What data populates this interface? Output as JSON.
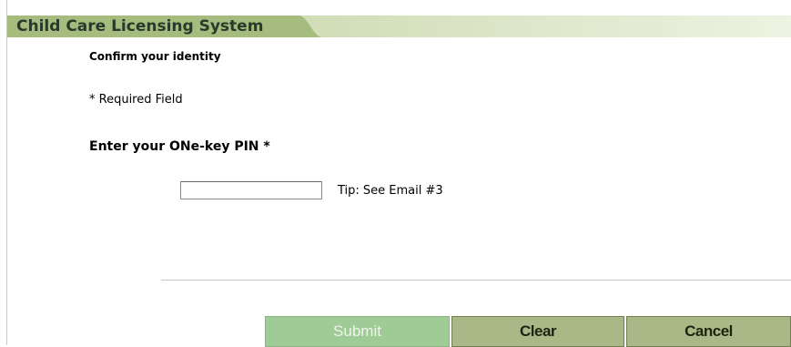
{
  "header": {
    "app_title": "Child Care Licensing System"
  },
  "form": {
    "section_heading": "Confirm your identity",
    "required_note": "* Required Field",
    "pin_label": "Enter your ONe-key PIN",
    "pin_required_marker": "*",
    "pin_value": "",
    "tip_text": "Tip: See Email #3"
  },
  "actions": {
    "submit_label": "Submit",
    "clear_label": "Clear",
    "cancel_label": "Cancel",
    "submit_enabled": false
  },
  "colors": {
    "header_light": "#e8efd8",
    "header_dark": "#a6bb7e",
    "button_fill": "#a9b886",
    "submit_fill_disabled": "#9ecb96",
    "divider": "#c4c4c4"
  }
}
